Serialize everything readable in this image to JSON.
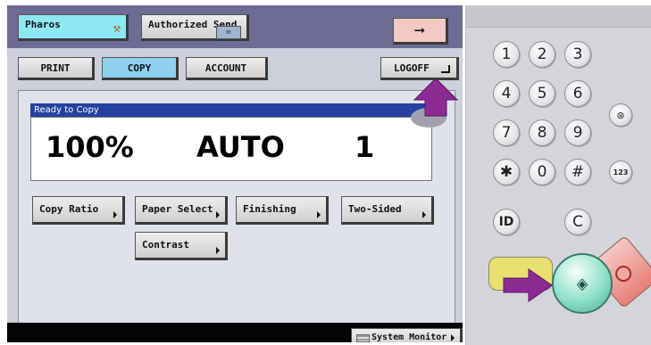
{
  "header": {
    "pharos_label": "Pharos",
    "authorized_send_label": "Authorized Send",
    "next_arrow": "➞"
  },
  "tabs": {
    "print": "PRINT",
    "copy": "COPY",
    "account": "ACCOUNT",
    "logoff": "LOGOFF"
  },
  "status": {
    "message": "Ready to Copy",
    "copy_ratio": "100%",
    "paper": "AUTO",
    "copies": "1"
  },
  "functions": {
    "copy_ratio": "Copy Ratio",
    "paper_select": "Paper Select",
    "finishing": "Finishing",
    "two_sided": "Two-Sided",
    "contrast": "Contrast"
  },
  "footer": {
    "system_monitor": "System Monitor"
  },
  "keypad": {
    "k1": "1",
    "k2": "2",
    "k3": "3",
    "k4": "4",
    "k5": "5",
    "k6": "6",
    "k7": "7",
    "k8": "8",
    "k9": "9",
    "kstar": "✱",
    "k0": "0",
    "khash": "#",
    "kid": "ID",
    "kclear": "C",
    "start_symbol": "◈",
    "counter_label": "123"
  },
  "colors": {
    "accent_pointer": "#8e2a93",
    "start_green": "#8fe0c8",
    "stop_red": "#e77f78",
    "selected_tab": "#8fd0ee",
    "status_bar": "#2540a0"
  },
  "icons": {
    "pharos": "pharos-logo-icon",
    "authorized_send": "send-envelope-icon",
    "pointer": "arrow-pointer-icon"
  }
}
